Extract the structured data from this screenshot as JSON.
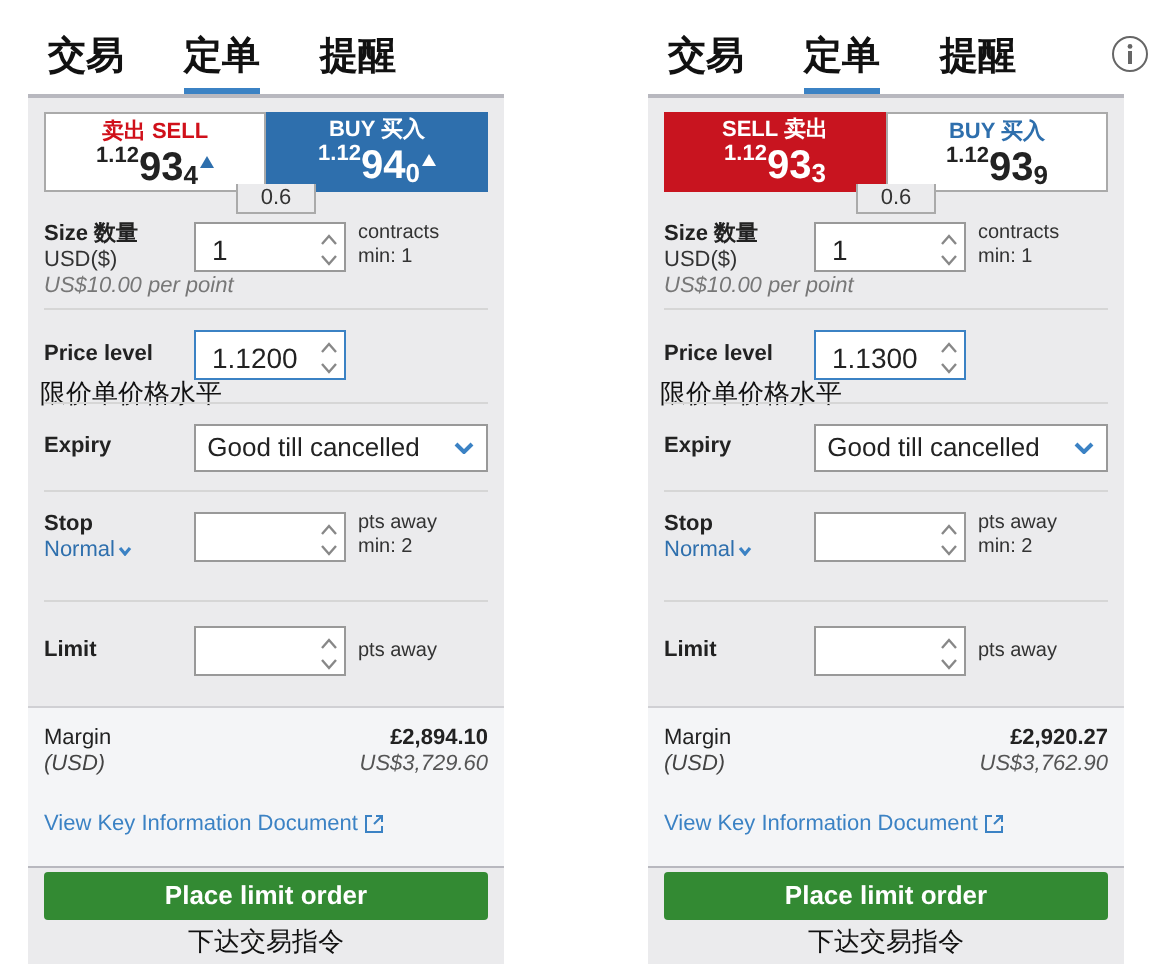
{
  "panels": [
    {
      "tabs": [
        {
          "label": "交易",
          "selected": false
        },
        {
          "label": "定单",
          "selected": true
        },
        {
          "label": "提醒",
          "selected": false
        }
      ],
      "info_button": false,
      "sell": {
        "label": "卖出 SELL",
        "prefix": "1.12",
        "big": "93",
        "small": "4",
        "tick_up": true,
        "selected": false
      },
      "buy": {
        "label": "BUY 买入",
        "prefix": "1.12",
        "big": "94",
        "small": "0",
        "tick_up": true,
        "selected": true
      },
      "spread": "0.6",
      "size": {
        "label": "Size 数量",
        "sublabel": "USD($)",
        "value": "1",
        "unit": "contracts",
        "min": "min: 1",
        "note": "US$10.00 per point"
      },
      "price_level": {
        "label": "Price level",
        "value": "1.1200",
        "focused": true,
        "annotation": "限价单价格水平"
      },
      "expiry": {
        "label": "Expiry",
        "value": "Good till cancelled"
      },
      "stop": {
        "label": "Stop",
        "type": "Normal",
        "unit": "pts away",
        "min": "min: 2"
      },
      "limit": {
        "label": "Limit",
        "unit": "pts away"
      },
      "margin": {
        "label": "Margin",
        "sublabel": "(USD)",
        "value": "£2,894.10",
        "value_usd": "US$3,729.60"
      },
      "link": "View Key Information Document",
      "button": "Place limit order",
      "caption": "下达交易指令"
    },
    {
      "tabs": [
        {
          "label": "交易",
          "selected": false
        },
        {
          "label": "定单",
          "selected": true
        },
        {
          "label": "提醒",
          "selected": false
        }
      ],
      "info_button": true,
      "sell": {
        "label": "SELL 卖出",
        "prefix": "1.12",
        "big": "93",
        "small": "3",
        "tick_up": false,
        "selected": true
      },
      "buy": {
        "label": "BUY 买入",
        "prefix": "1.12",
        "big": "93",
        "small": "9",
        "tick_up": false,
        "selected": false
      },
      "spread": "0.6",
      "size": {
        "label": "Size 数量",
        "sublabel": "USD($)",
        "value": "1",
        "unit": "contracts",
        "min": "min: 1",
        "note": "US$10.00 per point"
      },
      "price_level": {
        "label": "Price level",
        "value": "1.1300",
        "focused": true,
        "annotation": "限价单价格水平"
      },
      "expiry": {
        "label": "Expiry",
        "value": "Good till cancelled"
      },
      "stop": {
        "label": "Stop",
        "type": "Normal",
        "unit": "pts away",
        "min": "min: 2"
      },
      "limit": {
        "label": "Limit",
        "unit": "pts away"
      },
      "margin": {
        "label": "Margin",
        "sublabel": "(USD)",
        "value": "£2,920.27",
        "value_usd": "US$3,762.90"
      },
      "link": "View Key Information Document",
      "button": "Place limit order",
      "caption": "下达交易指令"
    }
  ]
}
